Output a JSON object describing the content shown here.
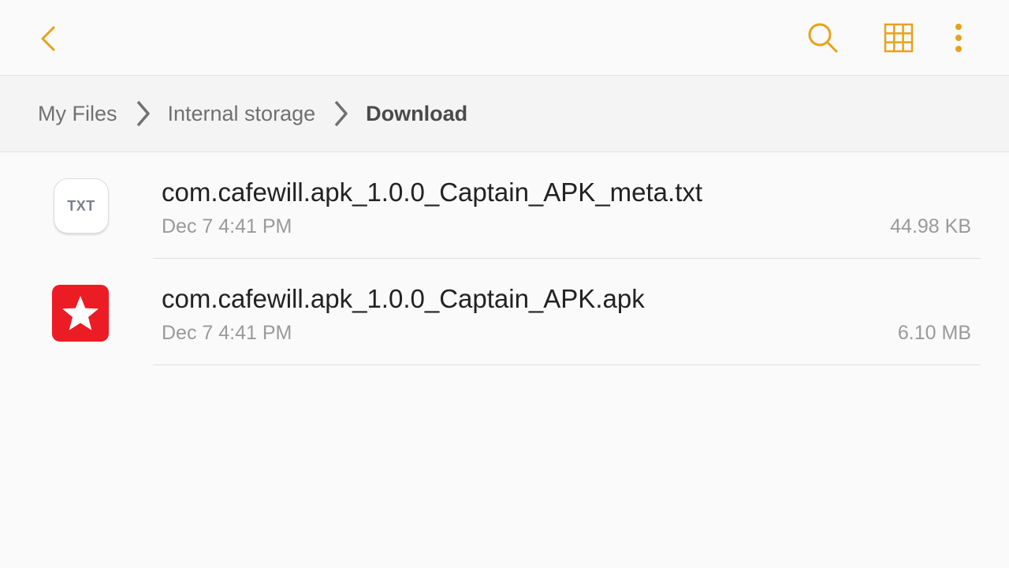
{
  "toolbar": {
    "back_icon": "back-arrow-icon",
    "search_icon": "search-icon",
    "grid_icon": "grid-view-icon",
    "more_icon": "more-options-icon",
    "accent_color": "#e8a21a"
  },
  "breadcrumb": {
    "items": [
      {
        "label": "My Files"
      },
      {
        "label": "Internal storage"
      },
      {
        "label": "Download"
      }
    ],
    "separator_icon": "chevron-right-icon"
  },
  "files": [
    {
      "name": "com.cafewill.apk_1.0.0_Captain_APK_meta.txt",
      "date": "Dec 7 4:41 PM",
      "size": "44.98 KB",
      "icon": "txt-file-icon",
      "icon_label": "TXT"
    },
    {
      "name": "com.cafewill.apk_1.0.0_Captain_APK.apk",
      "date": "Dec 7 4:41 PM",
      "size": "6.10 MB",
      "icon": "apk-star-icon",
      "icon_color": "#ec1c24"
    }
  ]
}
